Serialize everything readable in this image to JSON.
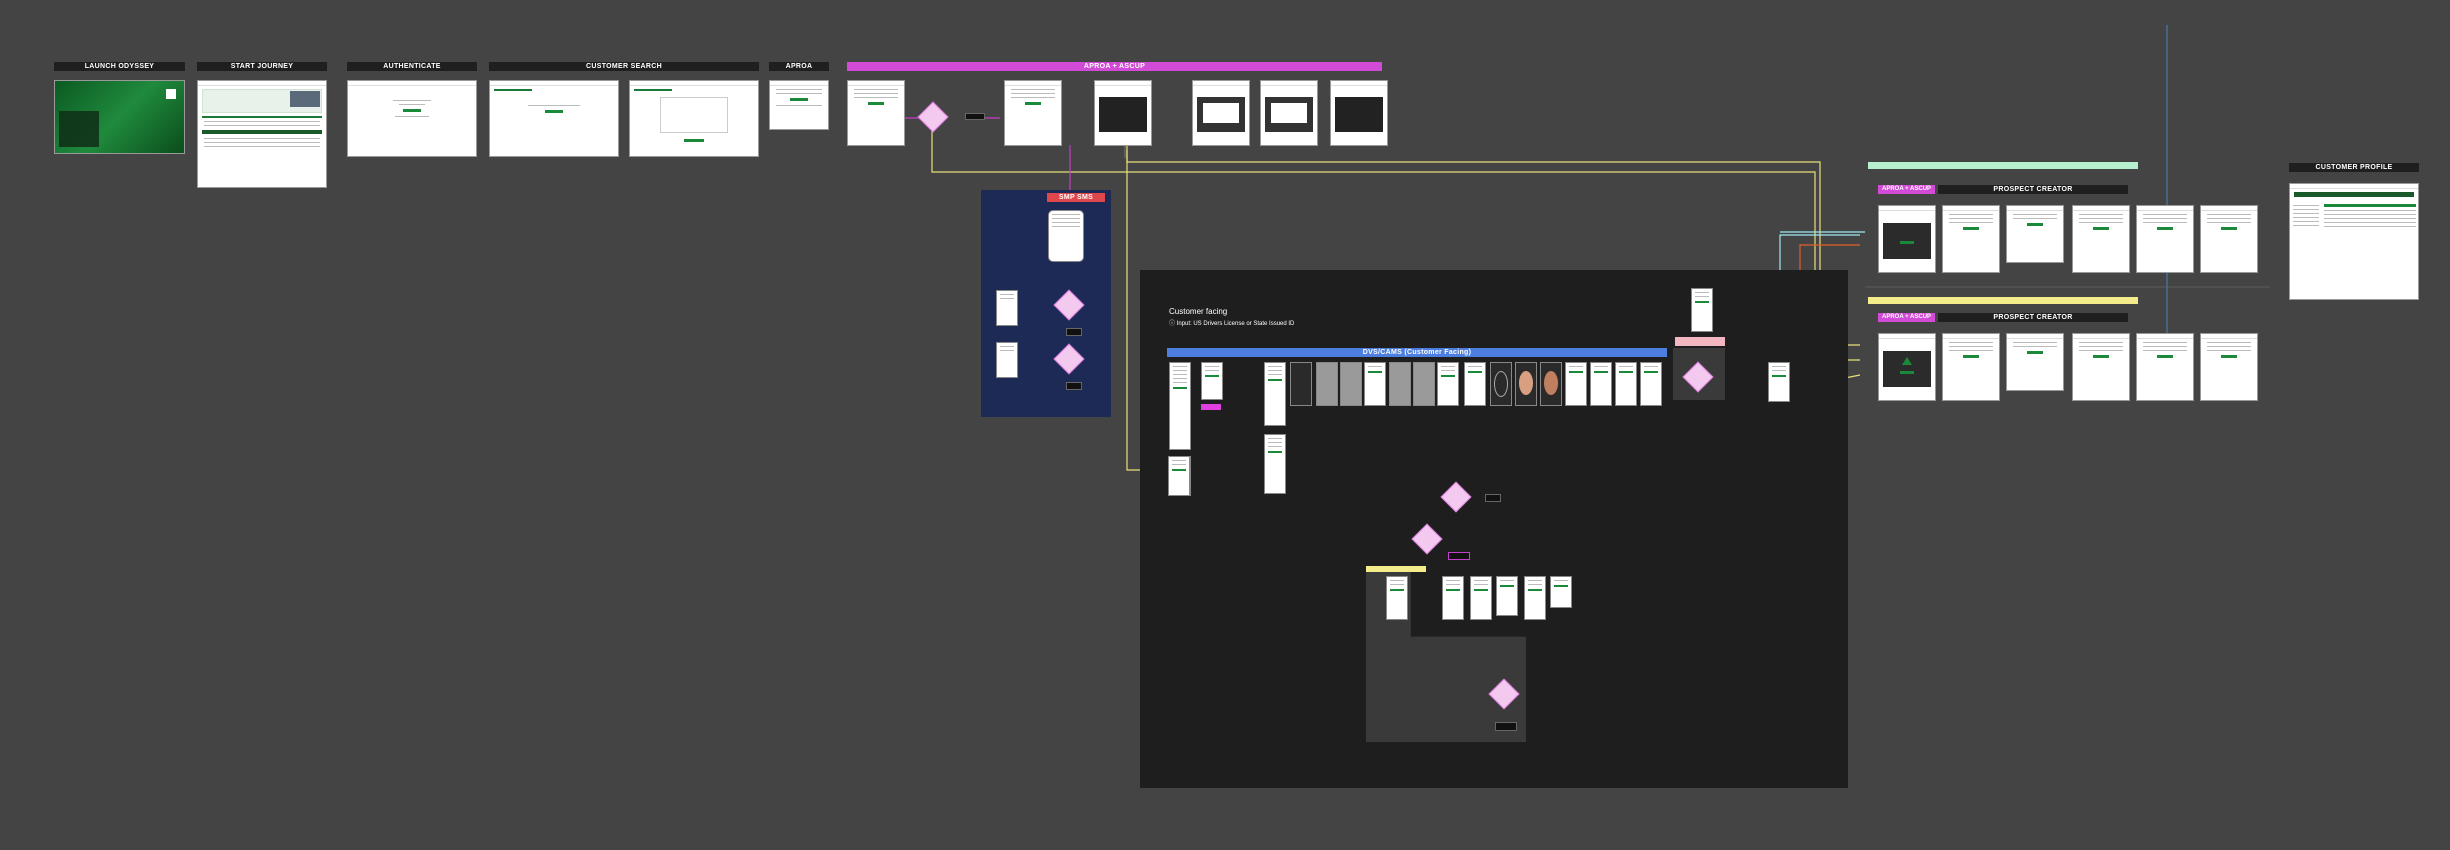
{
  "sections": {
    "launch_odyssey": "LAUNCH ODYSSEY",
    "start_journey": "START JOURNEY",
    "authenticate": "AUTHENTICATE",
    "customer_search": "CUSTOMER SEARCH",
    "aproa": "APROA",
    "aproa_ascup": "APROA + ASCUP",
    "sms_banner": "SMP SMS",
    "customer_facing_title": "Customer facing",
    "customer_facing_sub": "ⓘ Input: US Drivers License or State Issued ID",
    "idv_banner": "DVS/CAMS (Customer Facing)",
    "prospect_tag_1": "APROA + ASCUP",
    "prospect_title_1": "PROSPECT CREATOR",
    "prospect_tag_2": "APROA + ASCUP",
    "prospect_title_2": "PROSPECT CREATOR",
    "customer_profile": "CUSTOMER PROFILE"
  },
  "colors": {
    "canvas": "#444444",
    "section_label": "#1f1f1f",
    "magenta_banner": "#d24bd6",
    "navy_panel": "#1c2a55",
    "dark_panel": "#1e1e1e",
    "idv_blue": "#4d7fe0",
    "mint_bar": "#b6f0cf",
    "yellow_bar": "#f4ec8a",
    "decision_fill": "#f3c9f0",
    "connector_yellow": "#e8e07a",
    "connector_magenta": "#c33fc5",
    "connector_teal": "#9fe8f0",
    "connector_orange": "#e0602b",
    "brand_green": "#1a8a3a"
  },
  "icons": {
    "decision": "diamond-shape",
    "logo": "bank-logo-icon"
  }
}
